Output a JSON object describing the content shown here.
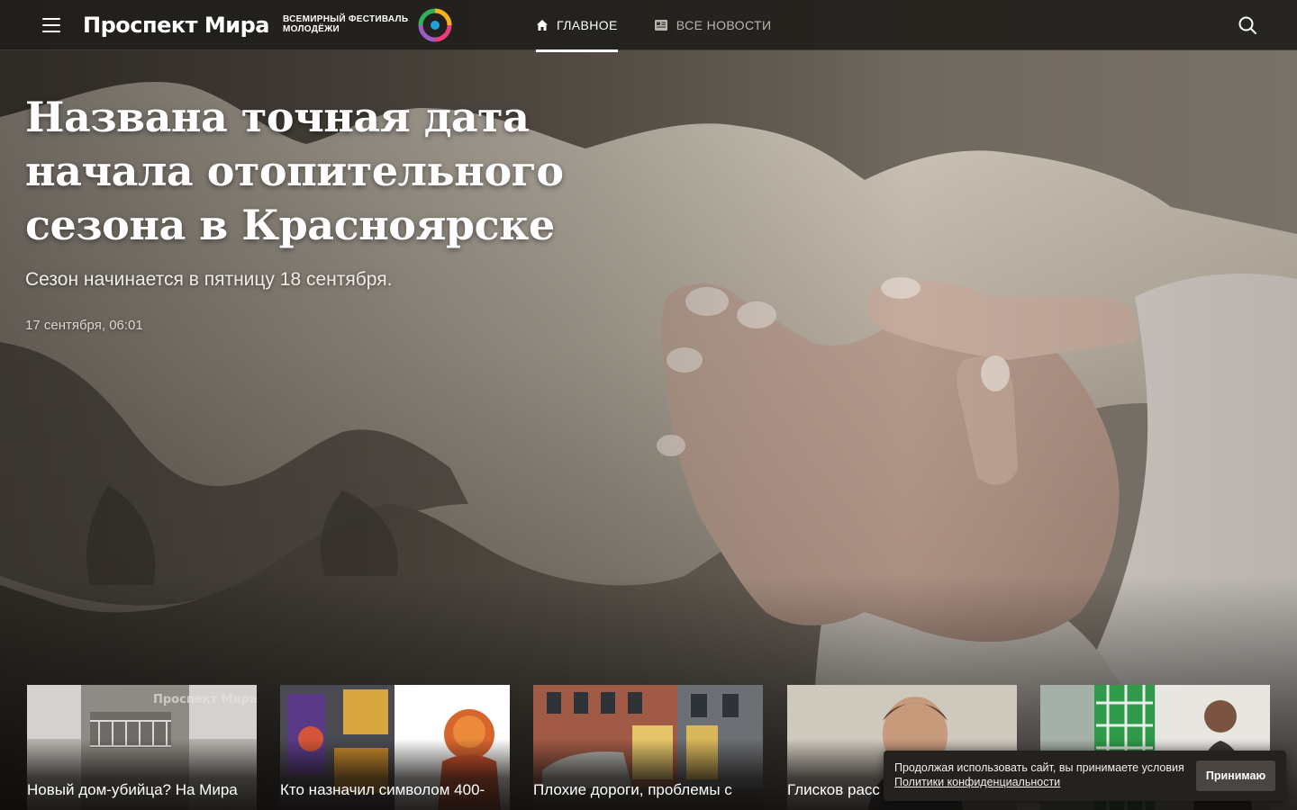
{
  "header": {
    "logo_text": "Проспект Мира",
    "festival_line1": "ВСЕМИРНЫЙ ФЕСТИВАЛЬ",
    "festival_line2": "МОЛОДЁЖИ",
    "nav": [
      {
        "label": "ГЛАВНОЕ",
        "icon": "home-icon",
        "active": true
      },
      {
        "label": "ВСЕ НОВОСТИ",
        "icon": "newspaper-icon",
        "active": false
      }
    ],
    "menu_icon": "hamburger-menu-icon",
    "search_icon": "search-icon"
  },
  "hero": {
    "headline": "Названа точная дата начала отопительного сезона в Красноярске",
    "lead": "Сезон начинается в пятницу 18 сентября.",
    "datetime": "17 сентября, 06:01"
  },
  "cards": [
    {
      "title": "Новый дом-убийца? На Мира",
      "watermark": "Проспект Мира"
    },
    {
      "title": "Кто назначил символом 400-"
    },
    {
      "title": "Плохие дороги, проблемы с"
    },
    {
      "title": "Глисков расс"
    },
    {
      "title": ""
    }
  ],
  "cookie": {
    "text": "Продолжая использовать сайт, вы принимаете условия",
    "link": "Политики конфиденциальности",
    "button": "Принимаю"
  },
  "colors": {
    "topbar_bg": "#211e1b",
    "accent": "#ffffff",
    "nav_inactive": "#b9b4ae",
    "cookie_bg": "#24211e",
    "cookie_button": "#4a4541"
  }
}
